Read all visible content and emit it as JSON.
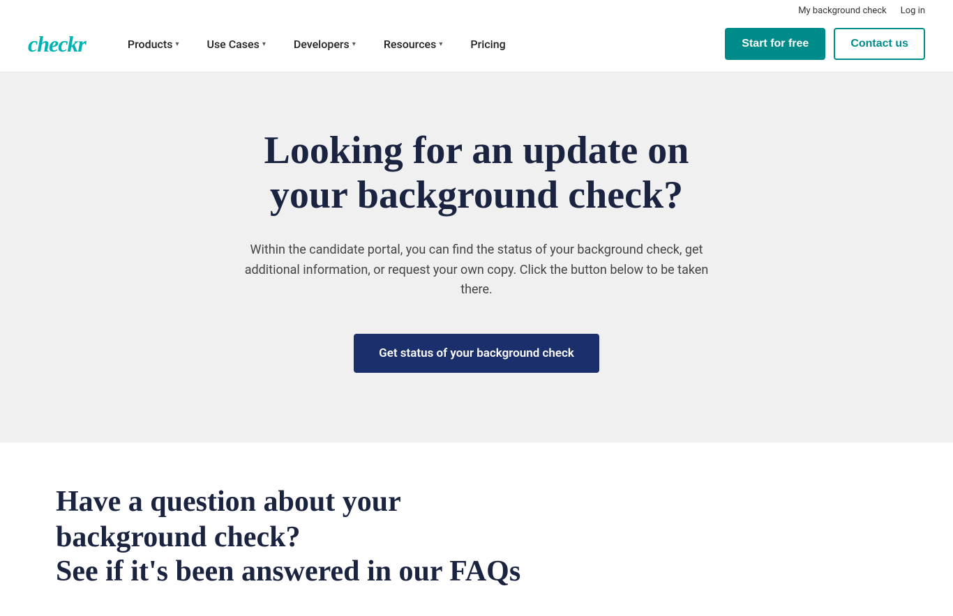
{
  "header": {
    "top_links": [
      {
        "label": "My background check",
        "name": "my-background-check-link"
      },
      {
        "label": "Log in",
        "name": "login-link"
      }
    ],
    "logo": "checkr",
    "nav_items": [
      {
        "label": "Products",
        "name": "products-nav",
        "has_chevron": true
      },
      {
        "label": "Use Cases",
        "name": "use-cases-nav",
        "has_chevron": true
      },
      {
        "label": "Developers",
        "name": "developers-nav",
        "has_chevron": true
      },
      {
        "label": "Resources",
        "name": "resources-nav",
        "has_chevron": true
      },
      {
        "label": "Pricing",
        "name": "pricing-nav",
        "has_chevron": false
      }
    ],
    "start_button": "Start for free",
    "contact_button": "Contact us"
  },
  "hero": {
    "title": "Looking for an update on your background check?",
    "description": "Within the candidate portal, you can find the status of your background check, get additional information, or request your own copy. Click the button below to be taken there.",
    "cta_button": "Get status of your background check"
  },
  "faq": {
    "title": "Have a question about your background check?",
    "subtitle": "See if it's been answered in our FAQs"
  },
  "colors": {
    "teal": "#008b8b",
    "navy": "#1a2340",
    "cta_navy": "#1a2f6b"
  }
}
